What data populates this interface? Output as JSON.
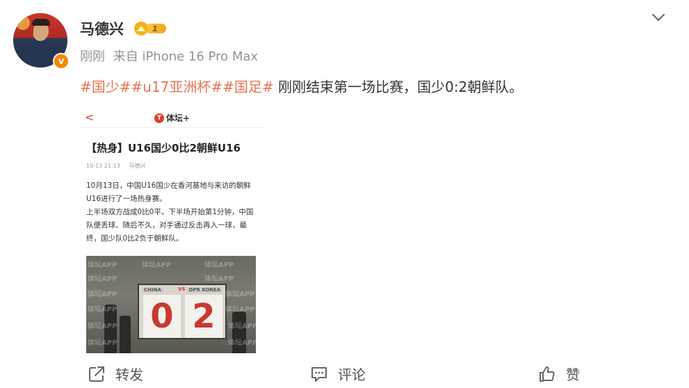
{
  "user": {
    "name": "马德兴",
    "level": "1",
    "verify_glyph": "v"
  },
  "meta": {
    "time": "刚刚",
    "source": "来自 iPhone 16 Pro Max"
  },
  "post": {
    "tags": [
      "#国少#",
      "#u17亚洲杯#",
      "#国足#"
    ],
    "text": " 刚刚结束第一场比赛，国少0:2朝鲜队。"
  },
  "screenshot": {
    "back": "<",
    "logo_mark": "T",
    "logo_text": "体坛+",
    "title": "【热身】U16国少0比2朝鲜U16",
    "date": "10-13 21:13",
    "author": "马德兴",
    "body": [
      "10月13日，中国U16国少在香河基地与来访的朝鲜U16进行了一场热身赛。",
      "上半场双方战成0比0平。下半场开始第1分钟，中国队便丢球。随后不久，对手通过反击再入一球，最终，国少队0比2负于朝鲜队。"
    ],
    "photo": {
      "team_left": "CHINA",
      "vs": "VS",
      "team_right": "DPR KOREA",
      "score_left": "0",
      "score_right": "2",
      "watermark": "体坛APP"
    }
  },
  "actions": {
    "repost": "转发",
    "comment": "评论",
    "like": "赞"
  },
  "colors": {
    "tag": "#eb7350",
    "verify": "#f78800",
    "meta": "#939393"
  }
}
